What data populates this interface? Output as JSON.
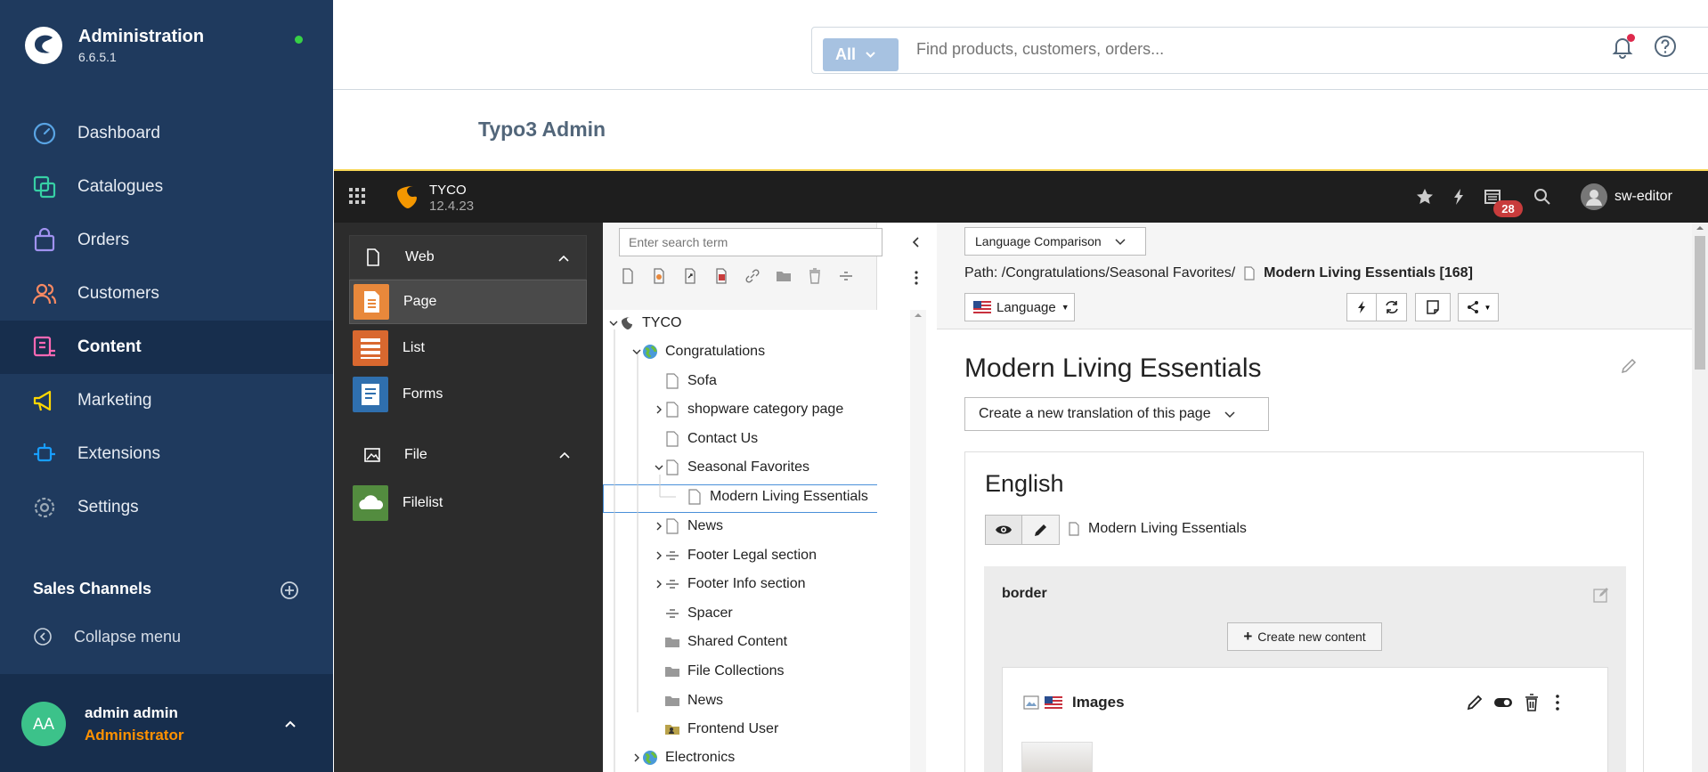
{
  "sidebar": {
    "brand_title": "Administration",
    "brand_version": "6.6.5.1",
    "items": [
      {
        "label": "Dashboard",
        "icon": "dashboard-icon",
        "color": "#59a4e4"
      },
      {
        "label": "Catalogues",
        "icon": "catalogue-icon",
        "color": "#37d0a5"
      },
      {
        "label": "Orders",
        "icon": "orders-icon",
        "color": "#a092f0"
      },
      {
        "label": "Customers",
        "icon": "customers-icon",
        "color": "#f88962"
      },
      {
        "label": "Content",
        "icon": "content-icon",
        "color": "#ff68b4"
      },
      {
        "label": "Marketing",
        "icon": "marketing-icon",
        "color": "#ffd700"
      },
      {
        "label": "Extensions",
        "icon": "extensions-icon",
        "color": "#189eff"
      },
      {
        "label": "Settings",
        "icon": "settings-icon",
        "color": "#9aa8b5"
      }
    ],
    "sales_channels": "Sales Channels",
    "collapse": "Collapse menu",
    "user": {
      "initials": "AA",
      "name": "admin admin",
      "role": "Administrator"
    }
  },
  "header": {
    "search_filter": "All",
    "search_placeholder": "Find products, customers, orders...",
    "page_title": "Typo3 Admin"
  },
  "typo3": {
    "site_name": "TYCO",
    "version": "12.4.23",
    "notification_count": "28",
    "username": "sw-editor",
    "modules": {
      "web_group": "Web",
      "web_items": [
        "Page",
        "List",
        "Forms"
      ],
      "file_group": "File",
      "file_items": [
        "Filelist"
      ]
    },
    "tree": {
      "search_placeholder": "Enter search term",
      "root": "TYCO",
      "nodes": [
        "Congratulations",
        "Sofa",
        "shopware category page",
        "Contact Us",
        "Seasonal Favorites",
        "Modern Living Essentials",
        "News",
        "Footer Legal section",
        "Footer Info section",
        "Spacer",
        "Shared Content",
        "File Collections",
        "News",
        "Frontend User",
        "Electronics"
      ]
    },
    "content": {
      "view_mode": "Language Comparison",
      "path_prefix": "Path: /Congratulations/Seasonal Favorites/",
      "path_page": "Modern Living Essentials [168]",
      "language_button": "Language",
      "page_title": "Modern Living Essentials",
      "translation_select": "Create a new translation of this page",
      "language_column": "English",
      "lang_page_title": "Modern Living Essentials",
      "column_name": "border",
      "create_content": "Create new content",
      "element_title": "Images"
    }
  }
}
